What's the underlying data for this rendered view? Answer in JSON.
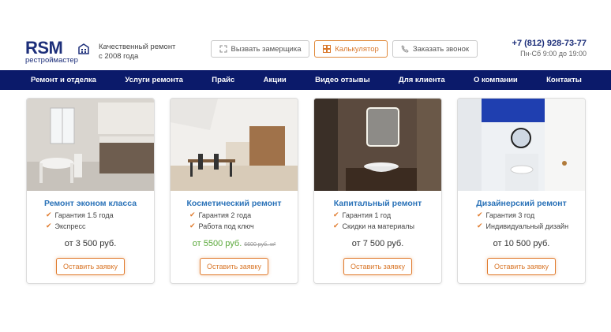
{
  "header": {
    "logo_mark": "RSM",
    "logo_sub": "рестроймастер",
    "tagline_line1": "Качественный ремонт",
    "tagline_line2": "с 2008 года",
    "buttons": [
      {
        "label": "Вызвать замерщика",
        "icon": "expand-icon"
      },
      {
        "label": "Калькулятор",
        "icon": "calculator-icon"
      },
      {
        "label": "Заказать звонок",
        "icon": "phone-icon"
      }
    ],
    "phone": "+7 (812) 928-73-77",
    "hours": "Пн-Сб 9:00 до 19:00"
  },
  "nav": {
    "items": [
      "Ремонт и отделка",
      "Услуги ремонта",
      "Прайс",
      "Акции",
      "Видео отзывы",
      "Для клиента",
      "О компании",
      "Контакты"
    ]
  },
  "cards": [
    {
      "title": "Ремонт эконом класса",
      "features": [
        "Гарантия 1.5 года",
        "Экспресс"
      ],
      "price": "от 3 500 руб.",
      "old_price": "",
      "button": "Оставить заявку"
    },
    {
      "title": "Косметический ремонт",
      "features": [
        "Гарантия 2 года",
        "Работа под ключ"
      ],
      "price": "от 5500 руб.",
      "old_price": "6600 руб. м²",
      "button": "Оставить заявку"
    },
    {
      "title": "Капитальный ремонт",
      "features": [
        "Гарантия 1 год",
        "Скидки на материалы"
      ],
      "price": "от 7 500 руб.",
      "old_price": "",
      "button": "Оставить заявку"
    },
    {
      "title": "Дизайнерский ремонт",
      "features": [
        "Гарантия 3 год",
        "Индивидуальный дизайн"
      ],
      "price": "от 10 500 руб.",
      "old_price": "",
      "button": "Оставить заявку"
    }
  ],
  "colors": {
    "accent": "#e07a2c",
    "nav": "#0b1a6a",
    "title": "#2a72b8",
    "promo_price": "#5aa83a"
  }
}
